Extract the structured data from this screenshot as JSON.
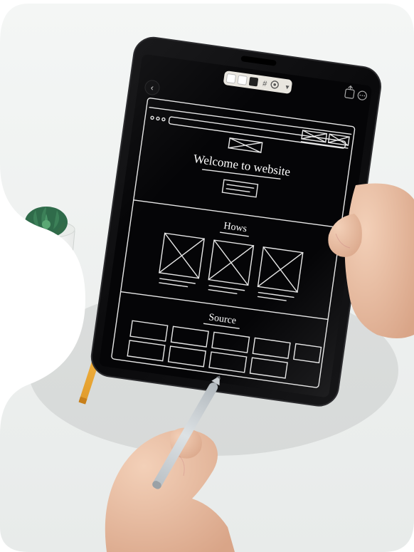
{
  "scene": {
    "description": "Photograph of hands holding a dark tablet displaying a hand-drawn website wireframe sketch, with a white desk, succulent plant in white pot, orange pencil, and a light grey stylus. Organic blob masking on edges.",
    "objects": {
      "plant": "succulent-plant",
      "pot": "white-pot",
      "pencil": "orange-pencil",
      "stylus": "grey-stylus",
      "tablet": "tablet-device",
      "hands": "human-hands"
    }
  },
  "tablet_toolbar": {
    "back": "‹",
    "icons": [
      "square-icon",
      "square-icon",
      "theme-toggle-icon",
      "hash-icon",
      "gear-icon"
    ],
    "right_icons": [
      "share-icon",
      "more-icon"
    ]
  },
  "wireframe": {
    "hero_title": "Welcome to website",
    "section1_title": "Hows",
    "section2_title": "Source"
  }
}
